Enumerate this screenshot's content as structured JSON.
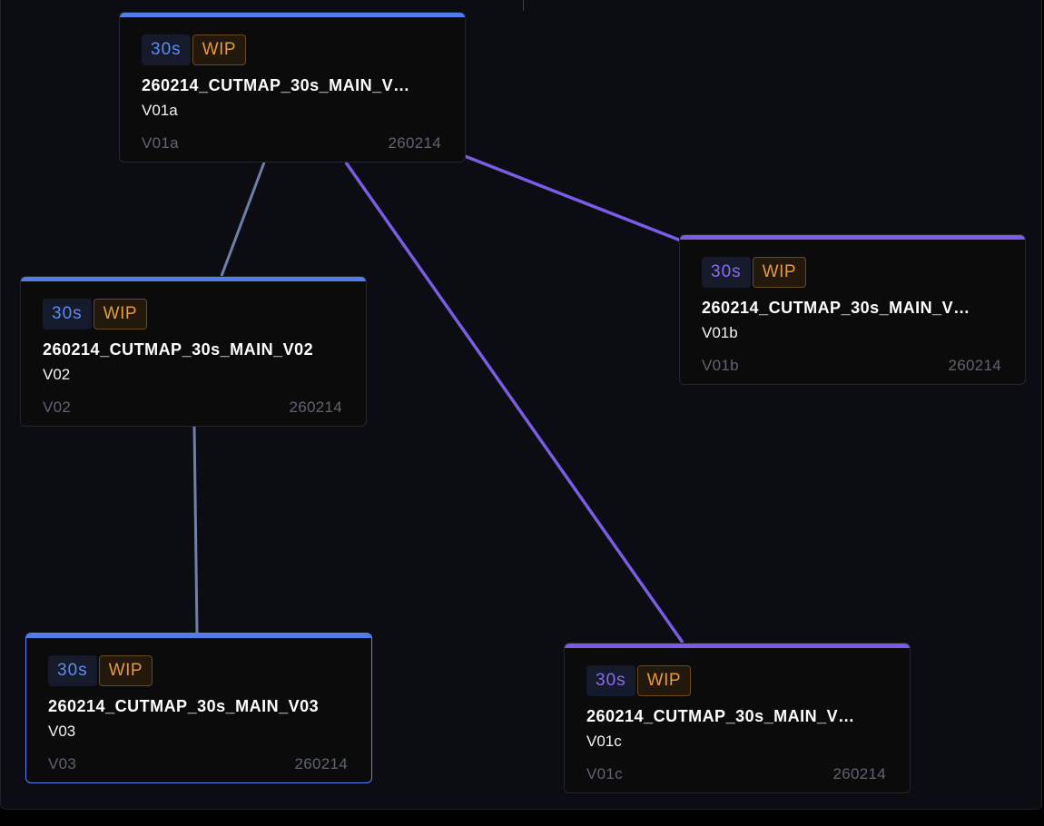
{
  "colors": {
    "blue_accent": "#4f7ee8",
    "purple_accent": "#7c5be6",
    "status_wip": "#e79a3a",
    "edge_gray": "#6f80a8",
    "edge_purple": "#7c5be6",
    "canvas_bg": "#0c0d12"
  },
  "nodes": [
    {
      "id": "V01a",
      "duration": "30s",
      "status": "WIP",
      "title": "260214_CUTMAP_30s_MAIN_V…",
      "subtitle": "V01a",
      "version": "V01a",
      "date": "260214",
      "color": "blue",
      "selected": false
    },
    {
      "id": "V01b",
      "duration": "30s",
      "status": "WIP",
      "title": "260214_CUTMAP_30s_MAIN_V…",
      "subtitle": "V01b",
      "version": "V01b",
      "date": "260214",
      "color": "purple",
      "selected": false
    },
    {
      "id": "V02",
      "duration": "30s",
      "status": "WIP",
      "title": "260214_CUTMAP_30s_MAIN_V02",
      "subtitle": "V02",
      "version": "V02",
      "date": "260214",
      "color": "blue",
      "selected": false
    },
    {
      "id": "V03",
      "duration": "30s",
      "status": "WIP",
      "title": "260214_CUTMAP_30s_MAIN_V03",
      "subtitle": "V03",
      "version": "V03",
      "date": "260214",
      "color": "blue",
      "selected": true
    },
    {
      "id": "V01c",
      "duration": "30s",
      "status": "WIP",
      "title": "260214_CUTMAP_30s_MAIN_V…",
      "subtitle": "V01c",
      "version": "V01c",
      "date": "260214",
      "color": "purple",
      "selected": false
    }
  ],
  "edges": [
    {
      "from": "V01a",
      "to": "V02",
      "style": "gray"
    },
    {
      "from": "V02",
      "to": "V03",
      "style": "gray"
    },
    {
      "from": "V01a",
      "to": "V01b",
      "style": "purple"
    },
    {
      "from": "V01a",
      "to": "V01c",
      "style": "purple"
    }
  ]
}
